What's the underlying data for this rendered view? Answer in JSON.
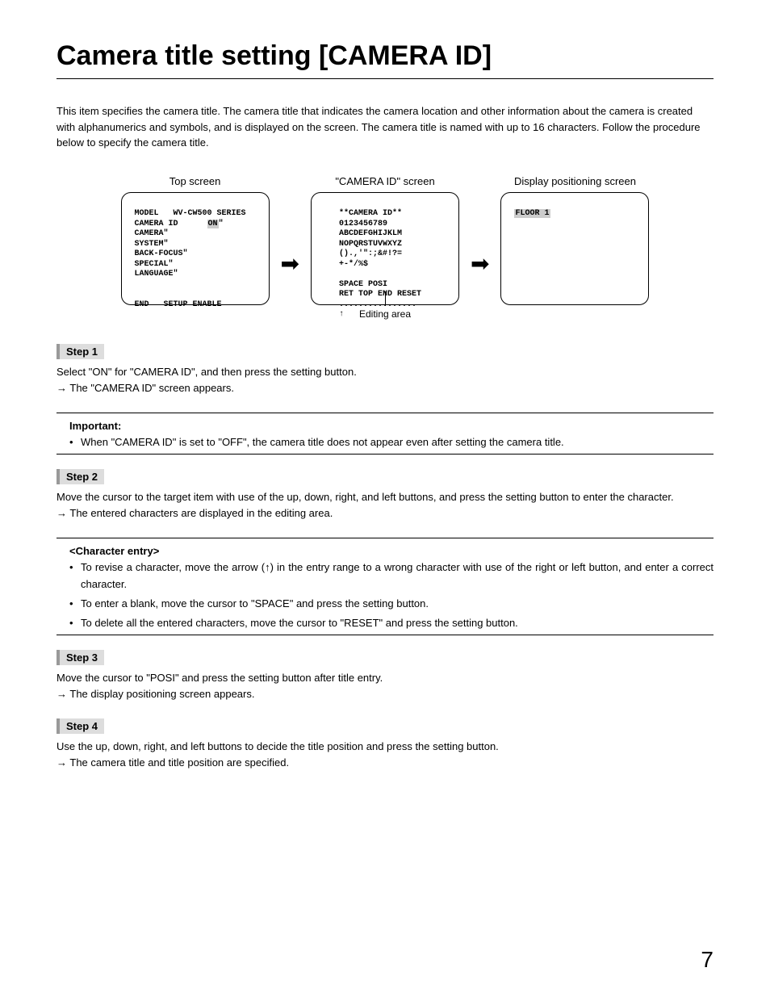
{
  "title": "Camera title setting [CAMERA ID]",
  "intro": "This item specifies the camera title. The camera title that indicates the camera location and other information about the camera is created with alphanumerics and symbols, and is displayed on the screen. The camera title is named with up to 16 characters. Follow the procedure below to specify the camera title.",
  "screens": {
    "top": {
      "label": "Top screen",
      "l1a": " MODEL   WV-CW500 SERIES",
      "l2a": " CAMERA ID      ",
      "l2b": "ON",
      "l2c": "\"",
      "l3": " CAMERA\"",
      "l4": " SYSTEM\"",
      "l5": " BACK-FOCUS\"",
      "l6": " SPECIAL\"",
      "l7": " LANGUAGE\"",
      "l8": "",
      "l9": "",
      "l10": " END   SETUP ENABLE"
    },
    "cam": {
      "label": "\"CAMERA ID\" screen",
      "l1": "    **CAMERA ID**",
      "l2": "    0123456789",
      "l3": "    ABCDEFGHIJKLM",
      "l4": "    NOPQRSTUVWXYZ",
      "l5": "    ().,'\":;&#!?=",
      "l6": "    +-*/%$",
      "l7": "",
      "l8": "    SPACE POSI",
      "l9": "    RET TOP END RESET",
      "dots": "    ................",
      "caret": "    ↑",
      "caption": "Editing area"
    },
    "pos": {
      "label": "Display positioning screen",
      "l1": " ",
      "l1b": "FLOOR 1"
    }
  },
  "steps": {
    "s1": {
      "head": "Step 1",
      "p": "Select \"ON\" for \"CAMERA ID\", and then press the setting button.",
      "r": "The \"CAMERA ID\" screen appears."
    },
    "important": {
      "head": "Important:",
      "b1": "When \"CAMERA ID\" is set to \"OFF\", the camera title does not appear even after setting the camera title."
    },
    "s2": {
      "head": "Step 2",
      "p": "Move the cursor to the target item with use of the up, down, right, and left buttons, and press the setting button to enter the character.",
      "r": "The entered characters are displayed in the editing area."
    },
    "charentry": {
      "head": "<Character entry>",
      "b1": "To revise a character, move the arrow (↑) in the entry range to a wrong character with use of the right or left button, and enter a correct character.",
      "b2": "To enter a blank, move the cursor to \"SPACE\" and press the setting button.",
      "b3": "To delete all the entered characters, move the cursor to \"RESET\" and press the setting button."
    },
    "s3": {
      "head": "Step 3",
      "p": "Move the cursor to \"POSI\" and press the setting button after title entry.",
      "r": "The display positioning screen appears."
    },
    "s4": {
      "head": "Step 4",
      "p": "Use the up, down, right, and left buttons to decide the title position and press the setting button.",
      "r": "The camera title and title position are specified."
    }
  },
  "page": "7"
}
